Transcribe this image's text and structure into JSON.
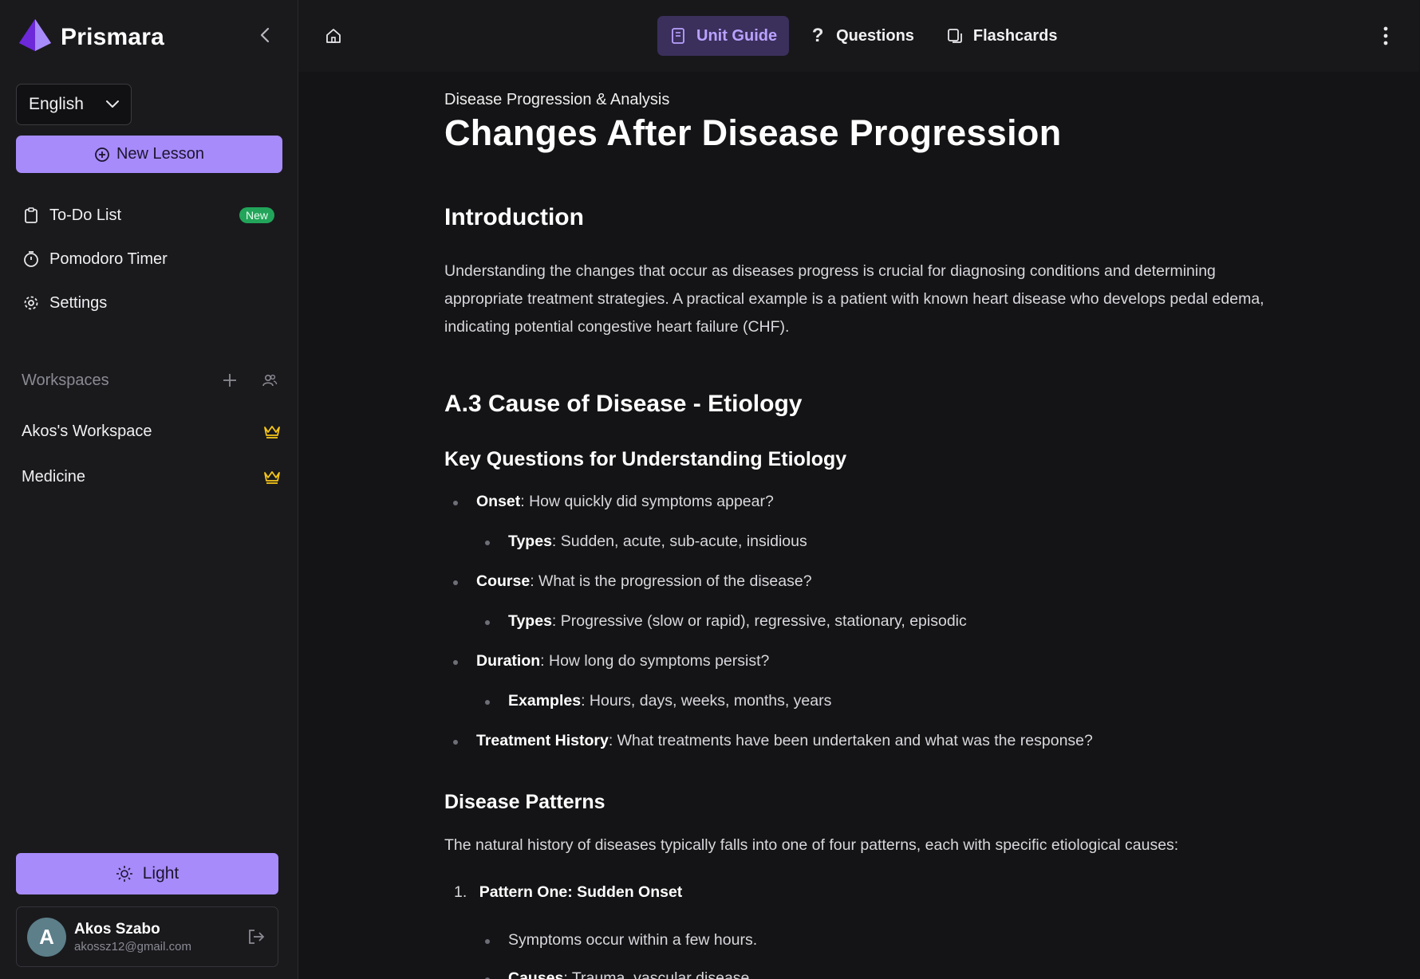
{
  "brand": {
    "name": "Prismara",
    "logo_color": "#8b5cf6"
  },
  "sidebar": {
    "language": "English",
    "new_lesson_label": "New Lesson",
    "nav": [
      {
        "label": "To-Do List",
        "icon": "clipboard-icon",
        "badge": "New"
      },
      {
        "label": "Pomodoro Timer",
        "icon": "timer-icon"
      },
      {
        "label": "Settings",
        "icon": "gear-icon"
      }
    ],
    "workspaces_label": "Workspaces",
    "workspaces": [
      {
        "label": "Akos's Workspace",
        "icon": "crown-icon"
      },
      {
        "label": "Medicine",
        "icon": "crown-icon"
      }
    ],
    "theme_button_label": "Light",
    "user": {
      "initial": "A",
      "name": "Akos Szabo",
      "email": "akossz12@gmail.com"
    }
  },
  "topbar": {
    "tabs": [
      {
        "label": "Unit Guide",
        "icon": "book-icon",
        "active": true
      },
      {
        "label": "Questions",
        "icon": "question-icon"
      },
      {
        "label": "Flashcards",
        "icon": "cards-icon"
      }
    ]
  },
  "colors": {
    "accent": "#a78bfa",
    "crown": "#f5c518",
    "badge_green": "#22a55a"
  },
  "article": {
    "breadcrumb": "Disease Progression & Analysis",
    "title": "Changes After Disease Progression",
    "intro_heading": "Introduction",
    "intro_text": "Understanding the changes that occur as diseases progress is crucial for diagnosing conditions and determining appropriate treatment strategies. A practical example is a patient with known heart disease who develops pedal edema, indicating potential congestive heart failure (CHF).",
    "section_heading": "A.3 Cause of Disease - Etiology",
    "key_questions_heading": "Key Questions for Understanding Etiology",
    "questions": [
      {
        "term": "Onset",
        "text": ": How quickly did symptoms appear?"
      },
      {
        "term": "Types",
        "text": ": Sudden, acute, sub-acute, insidious"
      },
      {
        "term": "Course",
        "text": ": What is the progression of the disease?"
      },
      {
        "term": "Types",
        "text": ": Progressive (slow or rapid), regressive, stationary, episodic"
      },
      {
        "term": "Duration",
        "text": ": How long do symptoms persist?"
      },
      {
        "term": "Examples",
        "text": ": Hours, days, weeks, months, years"
      },
      {
        "term": "Treatment History",
        "text": ": What treatments have been undertaken and what was the response?"
      }
    ],
    "patterns_heading": "Disease Patterns",
    "patterns_intro": "The natural history of diseases typically falls into one of four patterns, each with specific etiological causes:",
    "pattern_one": {
      "number": "1.",
      "title": "Pattern One: Sudden Onset"
    },
    "pattern_one_items": [
      {
        "text": "Symptoms occur within a few hours."
      },
      {
        "term": "Causes",
        "text": ": Trauma, vascular disease"
      }
    ]
  }
}
